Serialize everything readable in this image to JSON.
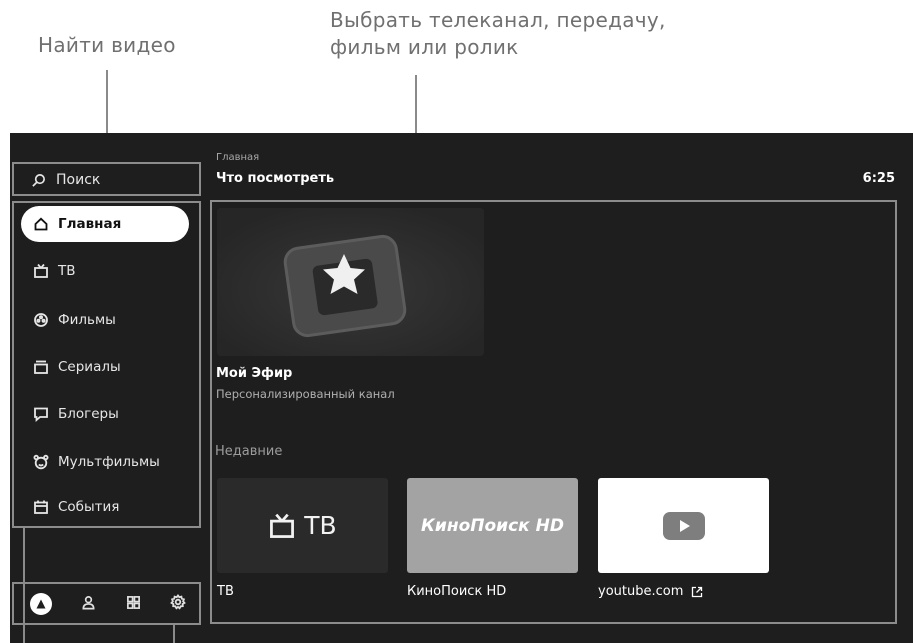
{
  "annotations": {
    "find_video": "Найти видео",
    "choose_line1": "Выбрать телеканал, передачу,",
    "choose_line2": "фильм или ролик"
  },
  "sidebar": {
    "search_label": "Поиск",
    "items": [
      {
        "label": "Главная",
        "icon": "home-icon",
        "active": true
      },
      {
        "label": "ТВ",
        "icon": "tv-icon",
        "active": false
      },
      {
        "label": "Фильмы",
        "icon": "film-reel-icon",
        "active": false
      },
      {
        "label": "Сериалы",
        "icon": "series-icon",
        "active": false
      },
      {
        "label": "Блогеры",
        "icon": "chat-icon",
        "active": false
      },
      {
        "label": "Мультфильмы",
        "icon": "cartoon-face-icon",
        "active": false
      },
      {
        "label": "События",
        "icon": "calendar-icon",
        "active": false
      }
    ],
    "bottom_icons": [
      "alice-icon",
      "profile-icon",
      "apps-grid-icon",
      "settings-gear-icon"
    ]
  },
  "header": {
    "breadcrumb": "Главная",
    "title": "Что посмотреть",
    "time": "6:25"
  },
  "featured": {
    "title": "Мой Эфир",
    "subtitle": "Персонализированный канал"
  },
  "recent": {
    "section_title": "Недавние",
    "tiles": [
      {
        "logo": "ТВ",
        "label": "ТВ"
      },
      {
        "logo": "КиноПоиск HD",
        "label": "КиноПоиск HD"
      },
      {
        "logo": "youtube",
        "label": "youtube.com"
      }
    ]
  },
  "colors": {
    "screen_bg": "#1e1e1e",
    "highlight_border": "#8c8c8c",
    "kinopoisk_tile": "#a3a3a3",
    "youtube_tile": "#ffffff"
  }
}
